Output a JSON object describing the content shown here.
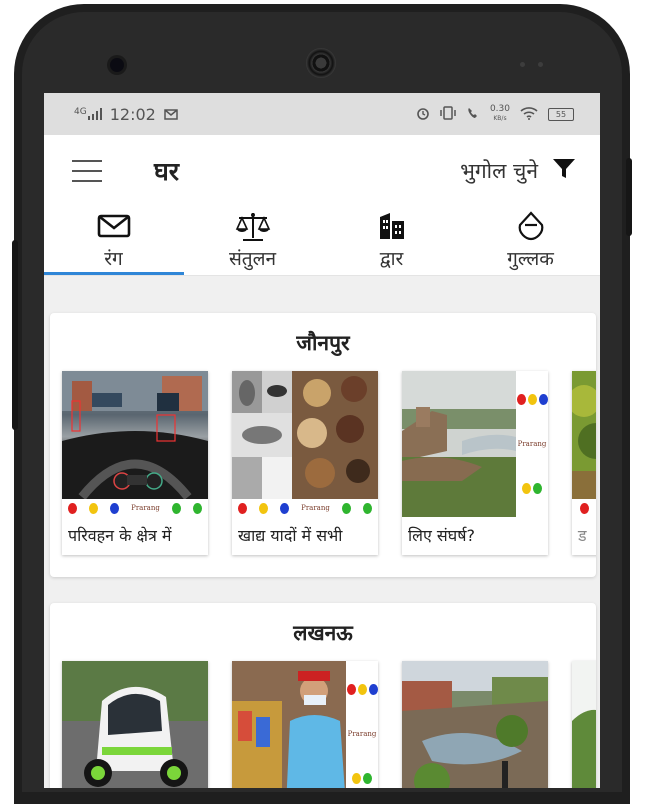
{
  "status_bar": {
    "network": "4G",
    "time": "12:02",
    "speed": "0.30",
    "speed_unit": "KB/s",
    "battery": "55"
  },
  "app_bar": {
    "title": "घर",
    "geo_label": "भुगोल चुने"
  },
  "tabs": [
    {
      "label": "रंग",
      "icon": "mail-icon",
      "active": true
    },
    {
      "label": "संतुलन",
      "icon": "scales-icon",
      "active": false
    },
    {
      "label": "द्वार",
      "icon": "building-icon",
      "active": false
    },
    {
      "label": "गुल्लक",
      "icon": "piggy-bank-icon",
      "active": false
    }
  ],
  "sections": [
    {
      "title": "जौनपुर",
      "articles": [
        {
          "caption": "परिवहन के क्षेत्र में",
          "image": "dashboard-driving-image"
        },
        {
          "caption": "खाद्य यादों में सभी",
          "image": "food-faces-collage-image"
        },
        {
          "caption": "लिए संघर्ष?",
          "image": "river-ghat-image"
        },
        {
          "caption": "ड",
          "image": "green-trees-image"
        }
      ]
    },
    {
      "title": "लखनऊ",
      "articles": [
        {
          "caption": "",
          "image": "electric-car-image"
        },
        {
          "caption": "",
          "image": "shopkeeper-mask-image"
        },
        {
          "caption": "",
          "image": "garbage-pond-image"
        },
        {
          "caption": "",
          "image": "green-field-image"
        }
      ]
    }
  ],
  "brand_label": "Prarang",
  "colors": {
    "accent": "#2f86d7",
    "dot_red": "#e02020",
    "dot_yellow": "#f2c40f",
    "dot_blue": "#1f3fd0",
    "dot_green": "#2fb52f"
  }
}
